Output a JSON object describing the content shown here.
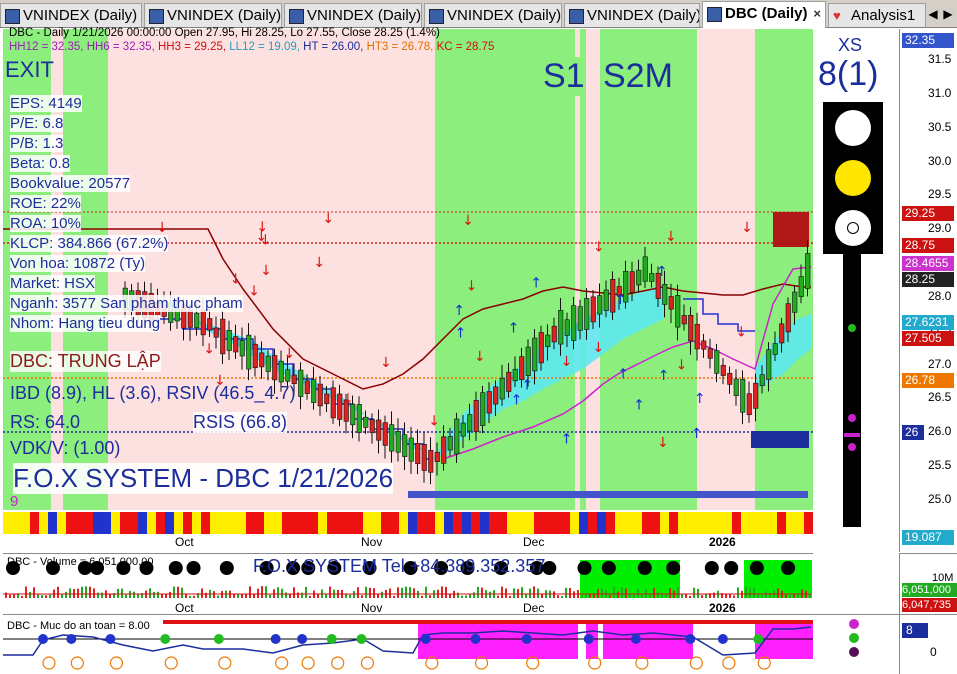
{
  "tabs": [
    {
      "label": "VNINDEX (Daily)",
      "icon": "chart-icon",
      "active": false
    },
    {
      "label": "VNINDEX (Daily)",
      "icon": "chart-icon",
      "active": false
    },
    {
      "label": "VNINDEX (Daily)",
      "icon": "chart-icon",
      "active": false
    },
    {
      "label": "VNINDEX (Daily)",
      "icon": "chart-icon",
      "active": false
    },
    {
      "label": "VNINDEX (Daily)",
      "icon": "chart-icon",
      "active": false
    },
    {
      "label": "DBC (Daily)",
      "icon": "chart-icon",
      "active": true
    },
    {
      "label": "Analysis1",
      "icon": "analysis-icon",
      "active": false
    }
  ],
  "tab_close_glyph": "×",
  "scroll_left_glyph": "◀",
  "scroll_right_glyph": "▶",
  "header": {
    "line1": "DBC - Daily 1/21/2026 00:00:00 Open 27.95, Hi 28.25, Lo 27.55, Close 28.25 (1.4%)",
    "levels": [
      {
        "text": "HH12 = 32.35,",
        "color": "#9b1fb8"
      },
      {
        "text": "HH6 = 32.35,",
        "color": "#9b1fb8"
      },
      {
        "text": "HH3 = 29.25,",
        "color": "#d01010"
      },
      {
        "text": "LL12 = 19.09,",
        "color": "#20a0c0"
      },
      {
        "text": "HT = 26.00,",
        "color": "#1c2d9c"
      },
      {
        "text": "HT3 = 26.78,",
        "color": "#e07000"
      },
      {
        "text": "KC = 28.75",
        "color": "#d01010"
      }
    ]
  },
  "overlay": {
    "exit": "EXIT",
    "signals": [
      "S1",
      "S2M"
    ],
    "xs_label": "XS",
    "xs_value": "8(1)",
    "fundamentals": [
      "EPS: 4149",
      "P/E: 6.8",
      "P/B: 1.3",
      "Beta: 0.8",
      "Bookvalue: 20577",
      "ROE: 22%",
      "ROA: 10%",
      "KLCP: 384.866 (67.2%)",
      "Von hoa: 10872 (Ty)",
      "Market: HSX",
      "Nganh: 3577 San pham thuc pham",
      "Nhom: Hang tieu dung"
    ],
    "status": "DBC: TRUNG LẬP",
    "ibd": "IBD (8.9), HL (3.6), RSIV (46.5_4.7)",
    "rs": "RS: 64.0",
    "rsis": "RSIS (66.8)",
    "vdk": "VDK/V:  (1.00)",
    "fox": "F.O.X SYSTEM - DBC 1/21/2026",
    "nine": "9",
    "volume_title": "F.O.X SYSTEM Tel +84.389.352.357"
  },
  "price_axis": {
    "ticks": [
      "31.5",
      "31.0",
      "30.5",
      "30.0",
      "29.5",
      "29.0",
      "28.5",
      "28.0",
      "27.5",
      "27.0",
      "26.5",
      "26.0",
      "25.5",
      "25.0"
    ],
    "tags": [
      {
        "value": "32.35",
        "color": "#3355cc"
      },
      {
        "value": "29.25",
        "color": "#cc1111"
      },
      {
        "value": "28.75",
        "color": "#cc1111"
      },
      {
        "value": "28.4655",
        "color": "#cc33cc"
      },
      {
        "value": "28.25",
        "color": "#222222"
      },
      {
        "value": "27.6231",
        "color": "#22aacc"
      },
      {
        "value": "27.505",
        "color": "#cc1111"
      },
      {
        "value": "26.78",
        "color": "#ee7700"
      },
      {
        "value": "26",
        "color": "#1c2d9c"
      },
      {
        "value": "19.087",
        "color": "#22aacc"
      }
    ]
  },
  "date_labels": [
    "Oct",
    "Nov",
    "Dec",
    "2026"
  ],
  "volume": {
    "title": "DBC - Volume = 6,051,000.00",
    "ticks": [
      "10M",
      "5M"
    ],
    "tags": [
      {
        "value": "6,051,000",
        "color": "#22aa22"
      },
      {
        "value": "6,047,735",
        "color": "#cc1111"
      }
    ]
  },
  "safety": {
    "title": "DBC - Muc do an toan = 8.00",
    "tick": "0",
    "tag": {
      "value": "8",
      "color": "#1c2d9c"
    }
  },
  "colors": {
    "bull_bg": "#8cee7c",
    "bear_bg": "#fde0e0",
    "cloud": "#5ee8f0",
    "text_blue": "#1c2d9c"
  }
}
